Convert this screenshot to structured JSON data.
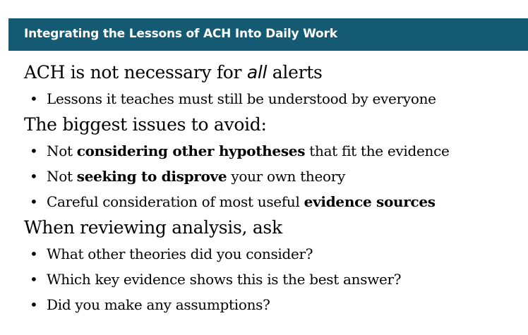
{
  "slide": {
    "title": "Integrating the Lessons of ACH Into Daily Work",
    "bullet_glyph": "•",
    "items": [
      {
        "level": 1,
        "parts": [
          {
            "text": "ACH is not necessary for "
          },
          {
            "text": "all",
            "style": "italic"
          },
          {
            "text": " alerts"
          }
        ]
      },
      {
        "level": 2,
        "parts": [
          {
            "text": "Lessons it teaches must still be understood by everyone"
          }
        ]
      },
      {
        "level": 1,
        "parts": [
          {
            "text": "The biggest issues to avoid:"
          }
        ]
      },
      {
        "level": 2,
        "parts": [
          {
            "text": "Not "
          },
          {
            "text": "considering other hypotheses",
            "style": "bold"
          },
          {
            "text": " that fit the evidence"
          }
        ]
      },
      {
        "level": 2,
        "parts": [
          {
            "text": "Not "
          },
          {
            "text": "seeking to disprove",
            "style": "bold"
          },
          {
            "text": " your own theory"
          }
        ]
      },
      {
        "level": 2,
        "parts": [
          {
            "text": "Careful consideration of most useful "
          },
          {
            "text": "evidence sources",
            "style": "bold"
          }
        ]
      },
      {
        "level": 1,
        "parts": [
          {
            "text": "When reviewing analysis, ask"
          }
        ]
      },
      {
        "level": 2,
        "parts": [
          {
            "text": "What other theories did you consider?"
          }
        ]
      },
      {
        "level": 2,
        "parts": [
          {
            "text": "Which key evidence shows this is the best answer?"
          }
        ]
      },
      {
        "level": 2,
        "parts": [
          {
            "text": "Did you make any assumptions?"
          }
        ]
      }
    ]
  },
  "colors": {
    "header_bg": "#135a72",
    "header_text": "#ffffff",
    "body_text": "#000000"
  }
}
